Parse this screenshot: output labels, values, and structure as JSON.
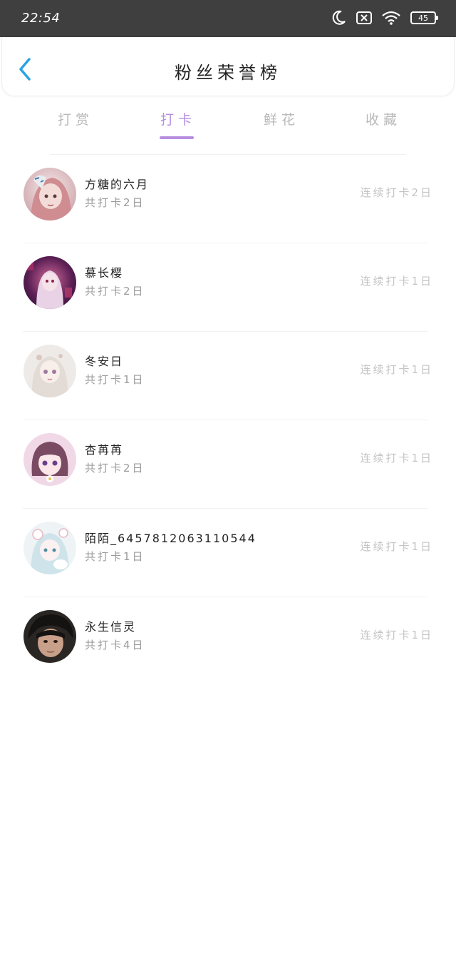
{
  "status_bar": {
    "time": "22:54",
    "battery": "45",
    "icons": [
      "moon-icon",
      "sim-disabled-icon",
      "wifi-icon",
      "battery-icon"
    ]
  },
  "header": {
    "back_icon": "chevron-left-icon",
    "title": "粉丝荣誉榜"
  },
  "tabs": [
    {
      "label": "打赏",
      "active": false
    },
    {
      "label": "打卡",
      "active": true
    },
    {
      "label": "鲜花",
      "active": false
    },
    {
      "label": "收藏",
      "active": false
    }
  ],
  "colors": {
    "accent": "#b58ee0",
    "back_icon": "#2aa3e6",
    "status_bar": "#3f3f3f"
  },
  "fans": [
    {
      "name": "方糖的六月",
      "total": "共打卡2日",
      "streak": "连续打卡2日"
    },
    {
      "name": "慕长樱",
      "total": "共打卡2日",
      "streak": "连续打卡1日"
    },
    {
      "name": "冬安日",
      "total": "共打卡1日",
      "streak": "连续打卡1日"
    },
    {
      "name": "杏苒苒",
      "total": "共打卡2日",
      "streak": "连续打卡1日"
    },
    {
      "name": "陌陌_6457812063110544",
      "total": "共打卡1日",
      "streak": "连续打卡1日"
    },
    {
      "name": "永生信灵",
      "total": "共打卡4日",
      "streak": "连续打卡1日"
    }
  ]
}
